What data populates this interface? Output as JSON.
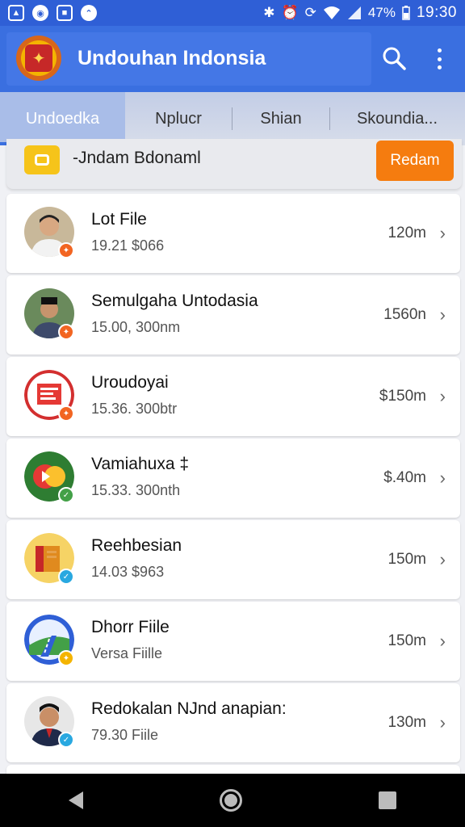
{
  "status_bar": {
    "battery": "47%",
    "time": "19:30",
    "left_icons": [
      "photo-icon",
      "settings-icon",
      "app-icon",
      "circle-icon"
    ],
    "right_icons": [
      "bluetooth-icon",
      "alarm-icon",
      "sync-icon",
      "wifi-icon",
      "signal-icon",
      "battery-icon"
    ]
  },
  "app_bar": {
    "title": "Undouhan Indonsia",
    "logo_icon": "emblem-icon",
    "search_icon": "search-icon",
    "more_icon": "more-vert-icon"
  },
  "tabs": [
    {
      "label": "Undoedka",
      "active": true
    },
    {
      "label": "Nplucr",
      "active": false
    },
    {
      "label": "Shian",
      "active": false
    },
    {
      "label": "Skoundia...",
      "active": false
    }
  ],
  "banner": {
    "text": "-Jndam Bdonaml",
    "button": "Redam",
    "icon": "chat-icon"
  },
  "rows": [
    {
      "title": "Lot File",
      "subtitle": "19.21 $066",
      "size": "120m",
      "avatar": "person-1",
      "badge_color": "#f26522"
    },
    {
      "title": "Semulgaha Untodasia",
      "subtitle": "15.00, 300nm",
      "size": "1560n",
      "avatar": "person-2",
      "badge_color": "#f26522"
    },
    {
      "title": "Uroudoyai",
      "subtitle": "15.36. 300btr",
      "size": "$150m",
      "avatar": "document-red",
      "badge_color": "#f26522"
    },
    {
      "title": "Vamiahuxa ‡",
      "subtitle": "15.33. 300nth",
      "size": "$.40m",
      "avatar": "play-icon",
      "badge_color": "#43a047"
    },
    {
      "title": "Reehbesian",
      "subtitle": "14.03 $963",
      "size": "150m",
      "avatar": "box-icon",
      "badge_color": "#29a8e0"
    },
    {
      "title": "Dhorr Fiile",
      "subtitle": "Versa Fiille",
      "size": "150m",
      "avatar": "road-icon",
      "badge_color": "#f4b400"
    },
    {
      "title": "Redokalan NJnd anapian:",
      "subtitle": "79.30 Fiile",
      "size": "130m",
      "avatar": "person-3",
      "badge_color": "#29a8e0"
    }
  ],
  "nav": {
    "back": "back-icon",
    "home": "home-icon",
    "recent": "recents-icon"
  }
}
